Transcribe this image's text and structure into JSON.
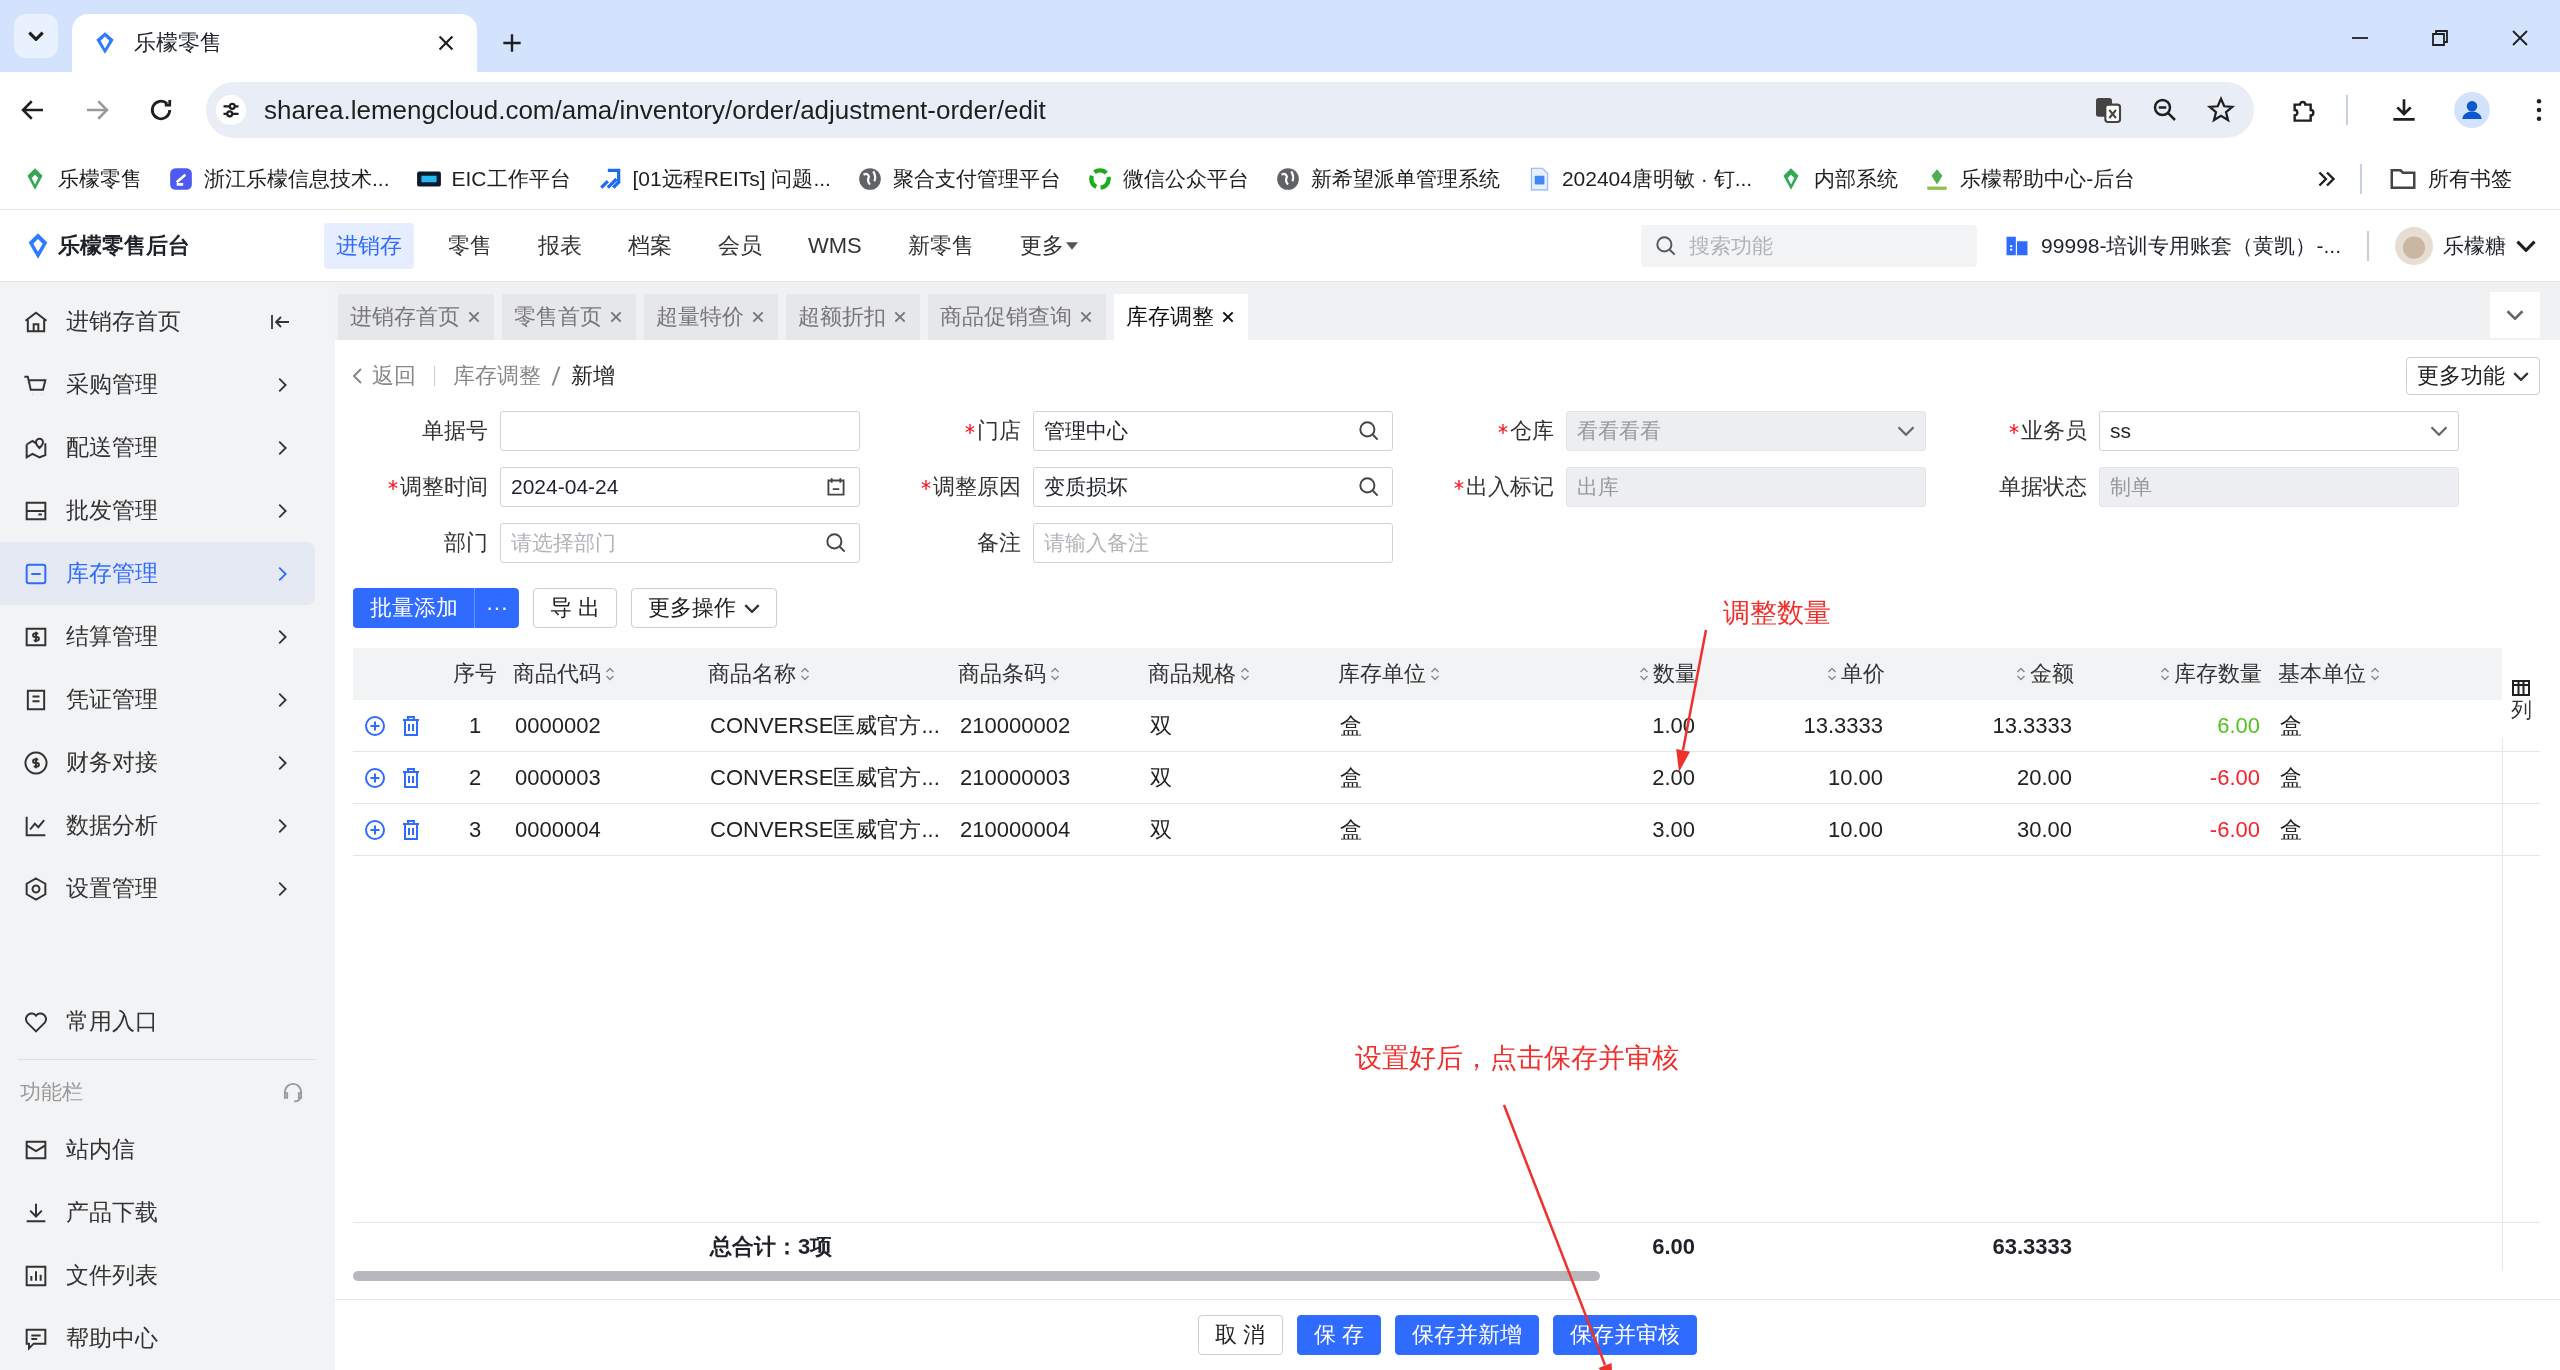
{
  "browser": {
    "tab_title": "乐檬零售",
    "url": "sharea.lemengcloud.com/ama/inventory/order/adjustment-order/edit",
    "bookmarks": [
      {
        "label": "乐檬零售"
      },
      {
        "label": "浙江乐檬信息技术..."
      },
      {
        "label": "EIC工作平台"
      },
      {
        "label": "[01远程REITs] 问题..."
      },
      {
        "label": "聚合支付管理平台"
      },
      {
        "label": "微信公众平台"
      },
      {
        "label": "新希望派单管理系统"
      },
      {
        "label": "202404唐明敏 · 钉..."
      },
      {
        "label": "内部系统"
      },
      {
        "label": "乐檬帮助中心-后台"
      }
    ],
    "all_bookmarks": "所有书签"
  },
  "app": {
    "brand": "乐檬零售后台",
    "nav": [
      {
        "label": "进销存",
        "selected": true,
        "dropdown": false
      },
      {
        "label": "零售",
        "selected": false,
        "dropdown": false
      },
      {
        "label": "报表",
        "selected": false,
        "dropdown": false
      },
      {
        "label": "档案",
        "selected": false,
        "dropdown": false
      },
      {
        "label": "会员",
        "selected": false,
        "dropdown": false
      },
      {
        "label": "WMS",
        "selected": false,
        "dropdown": false
      },
      {
        "label": "新零售",
        "selected": false,
        "dropdown": false
      },
      {
        "label": "更多",
        "selected": false,
        "dropdown": true
      }
    ],
    "search_placeholder": "搜索功能",
    "account": "99998-培训专用账套（黄凯）-...",
    "user": "乐檬糖"
  },
  "sidebar": {
    "items": [
      {
        "label": "进销存首页",
        "selected": false,
        "kind": "home"
      },
      {
        "label": "采购管理",
        "selected": false,
        "kind": "menu"
      },
      {
        "label": "配送管理",
        "selected": false,
        "kind": "menu"
      },
      {
        "label": "批发管理",
        "selected": false,
        "kind": "menu"
      },
      {
        "label": "库存管理",
        "selected": true,
        "kind": "menu"
      },
      {
        "label": "结算管理",
        "selected": false,
        "kind": "menu"
      },
      {
        "label": "凭证管理",
        "selected": false,
        "kind": "menu"
      },
      {
        "label": "财务对接",
        "selected": false,
        "kind": "menu"
      },
      {
        "label": "数据分析",
        "selected": false,
        "kind": "menu"
      },
      {
        "label": "设置管理",
        "selected": false,
        "kind": "menu"
      }
    ],
    "favorites": "常用入口",
    "tools_title": "功能栏",
    "tools": [
      {
        "label": "站内信"
      },
      {
        "label": "产品下载"
      },
      {
        "label": "文件列表"
      },
      {
        "label": "帮助中心"
      }
    ]
  },
  "page_tabs": [
    {
      "label": "进销存首页",
      "selected": false
    },
    {
      "label": "零售首页",
      "selected": false
    },
    {
      "label": "超量特价",
      "selected": false
    },
    {
      "label": "超额折扣",
      "selected": false
    },
    {
      "label": "商品促销查询",
      "selected": false
    },
    {
      "label": "库存调整",
      "selected": true
    }
  ],
  "breadcrumb": {
    "back": "返回",
    "parent": "库存调整",
    "current": "新增"
  },
  "more_functions": "更多功能",
  "form": {
    "fields": [
      {
        "label": "单据号",
        "required": false,
        "disabled": false,
        "kind": "text"
      },
      {
        "label": "门店",
        "required": true,
        "disabled": false,
        "value": "管理中心",
        "kind": "search"
      },
      {
        "label": "仓库",
        "required": true,
        "disabled": true,
        "value": "看看看看",
        "kind": "select"
      },
      {
        "label": "业务员",
        "required": true,
        "disabled": false,
        "value": "ss",
        "kind": "select"
      },
      {
        "label": "调整时间",
        "required": true,
        "disabled": false,
        "value": "2024-04-24",
        "kind": "date"
      },
      {
        "label": "调整原因",
        "required": true,
        "disabled": false,
        "value": "变质损坏",
        "kind": "search"
      },
      {
        "label": "出入标记",
        "required": true,
        "disabled": true,
        "value": "出库",
        "kind": "text"
      },
      {
        "label": "单据状态",
        "required": false,
        "disabled": true,
        "value": "制单",
        "kind": "text"
      },
      {
        "label": "部门",
        "required": false,
        "disabled": false,
        "placeholder": "请选择部门",
        "kind": "search"
      },
      {
        "label": "备注",
        "required": false,
        "disabled": false,
        "placeholder": "请输入备注",
        "kind": "text"
      }
    ]
  },
  "actions": {
    "batch_add": "批量添加",
    "batch_more": "···",
    "export": "导 出",
    "more_ops": "更多操作"
  },
  "table": {
    "columns": [
      {
        "label": "序号",
        "sortable": false,
        "kind": "index"
      },
      {
        "label": "商品代码",
        "sortable": true,
        "kind": "text"
      },
      {
        "label": "商品名称",
        "sortable": true,
        "kind": "text"
      },
      {
        "label": "商品条码",
        "sortable": true,
        "kind": "text"
      },
      {
        "label": "商品规格",
        "sortable": true,
        "kind": "text"
      },
      {
        "label": "库存单位",
        "sortable": true,
        "kind": "text"
      },
      {
        "label": "数量",
        "sortable": true,
        "kind": "number"
      },
      {
        "label": "单价",
        "sortable": true,
        "kind": "number"
      },
      {
        "label": "金额",
        "sortable": true,
        "kind": "number"
      },
      {
        "label": "库存数量",
        "sortable": true,
        "kind": "stock"
      },
      {
        "label": "基本单位",
        "sortable": true,
        "kind": "text"
      }
    ],
    "rows": [
      {
        "cells": [
          "1",
          "0000002",
          "CONVERSE匡威官方...",
          "210000002",
          "双",
          "盒",
          "1.00",
          "13.3333",
          "13.3333",
          "6.00",
          "盒"
        ],
        "color": "#52c41a"
      },
      {
        "cells": [
          "2",
          "0000003",
          "CONVERSE匡威官方...",
          "210000003",
          "双",
          "盒",
          "2.00",
          "10.00",
          "20.00",
          "-6.00",
          "盒"
        ],
        "color": "#f5222d"
      },
      {
        "cells": [
          "3",
          "0000004",
          "CONVERSE匡威官方...",
          "210000004",
          "双",
          "盒",
          "3.00",
          "10.00",
          "30.00",
          "-6.00",
          "盒"
        ],
        "color": "#f5222d"
      }
    ],
    "column_settings": "列",
    "summary": {
      "label": "总合计：3项",
      "qty": "6.00",
      "amount": "63.3333"
    }
  },
  "annotations": [
    {
      "text": "调整数量"
    },
    {
      "text": "设置好后，点击保存并审核"
    }
  ],
  "footer_buttons": [
    {
      "label": "取 消",
      "kind": "default"
    },
    {
      "label": "保 存",
      "kind": "primary"
    },
    {
      "label": "保存并新增",
      "kind": "primary"
    },
    {
      "label": "保存并审核",
      "kind": "primary"
    }
  ]
}
